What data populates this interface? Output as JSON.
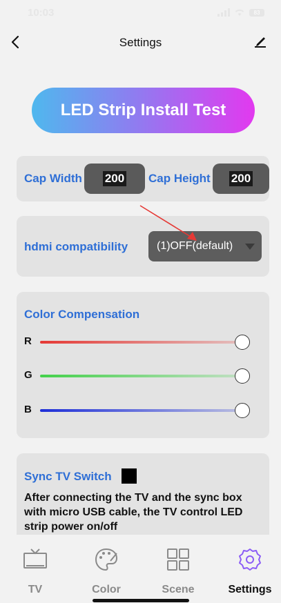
{
  "status": {
    "time": "10:03",
    "battery": "83"
  },
  "nav": {
    "title": "Settings"
  },
  "hero": {
    "label": "LED Strip Install Test"
  },
  "cap": {
    "width_label": "Cap Width",
    "width_value": "200",
    "height_label": "Cap Height",
    "height_value": "200"
  },
  "hdmi": {
    "label": "hdmi compatibility",
    "selected": "(1)OFF(default)"
  },
  "color": {
    "title": "Color Compensation",
    "sliders": [
      {
        "letter": "R",
        "value": 100,
        "color": "#e53935"
      },
      {
        "letter": "G",
        "value": 100,
        "color": "#43d14a"
      },
      {
        "letter": "B",
        "value": 100,
        "color": "#1e2fd8"
      }
    ]
  },
  "sync": {
    "title": "Sync TV Switch",
    "description": "After connecting the TV and the sync box with micro USB cable, the TV control LED strip power on/off"
  },
  "tabs": [
    {
      "label": "TV",
      "icon": "tv-icon",
      "active": false
    },
    {
      "label": "Color",
      "icon": "palette-icon",
      "active": false
    },
    {
      "label": "Scene",
      "icon": "grid-icon",
      "active": false
    },
    {
      "label": "Settings",
      "icon": "gear-icon",
      "active": true
    }
  ],
  "colors": {
    "accent": "#2f6fd6",
    "active_tab": "#8b5cf6",
    "tab_inactive": "#8a8a8a"
  }
}
